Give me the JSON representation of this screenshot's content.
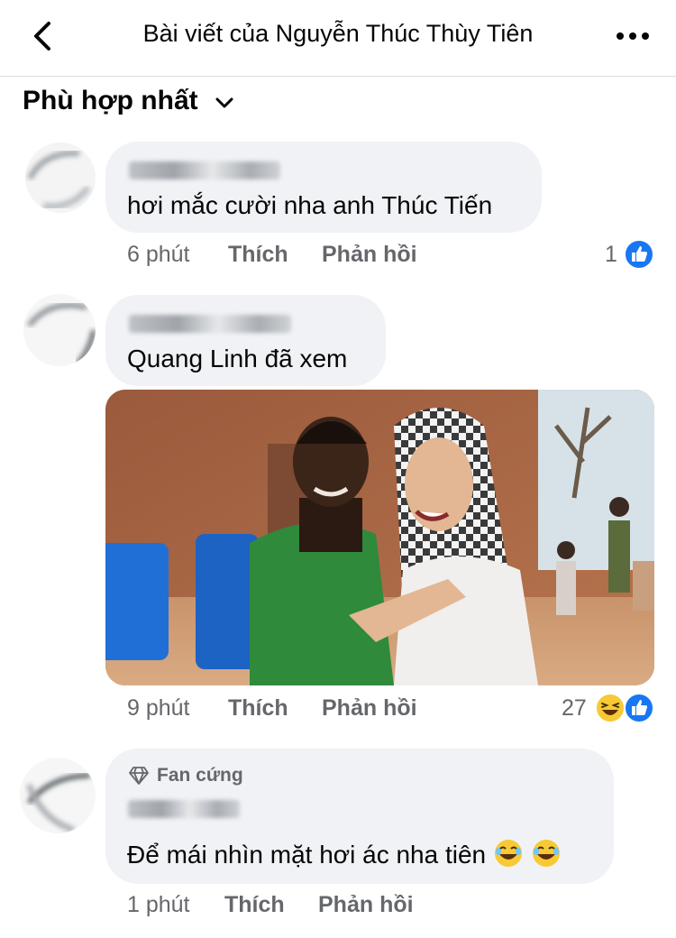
{
  "header": {
    "title": "Bài viết của Nguyễn Thúc Thùy Tiên",
    "back_icon": "chevron-left-icon",
    "more_icon": "more-horizontal-icon"
  },
  "sort": {
    "label": "Phù hợp nhất",
    "icon": "chevron-down-icon"
  },
  "comments": [
    {
      "text": "hơi mắc cười nha anh Thúc Tiến",
      "time": "6 phút",
      "like": "Thích",
      "reply": "Phản hồi",
      "reaction_count": "1",
      "reactions": [
        "like"
      ]
    },
    {
      "text": "Quang Linh đã xem",
      "time": "9 phút",
      "like": "Thích",
      "reply": "Phản hồi",
      "reaction_count": "27",
      "reactions": [
        "haha",
        "like"
      ],
      "has_image": true
    },
    {
      "badge": "Fan cứng",
      "badge_icon": "diamond-icon",
      "text": "Để mái nhìn mặt hơi ác nha tiên",
      "emojis": [
        "laughing-emoji",
        "laughing-emoji"
      ],
      "time": "1 phút",
      "like": "Thích",
      "reply": "Phản hồi"
    }
  ],
  "colors": {
    "bubble": "#f0f2f5",
    "meta": "#65676b",
    "like_blue": "#1877f2",
    "haha_yellow": "#f7c934"
  }
}
